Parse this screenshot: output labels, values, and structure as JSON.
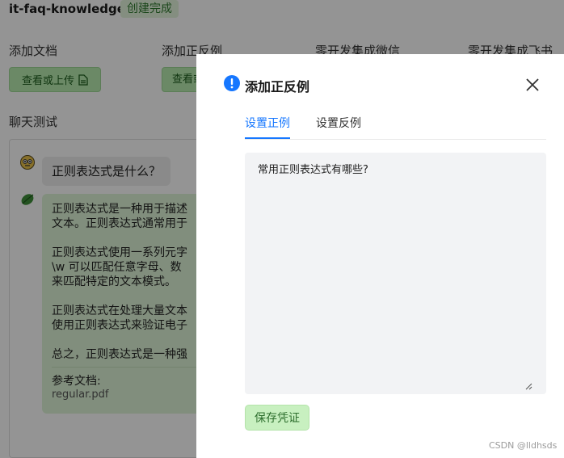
{
  "header": {
    "kb_name": "it-faq-knowledge",
    "status": "创建完成"
  },
  "sections": {
    "add_doc": "添加文档",
    "add_examples": "添加正反例",
    "wechat": "零开发集成微信",
    "feishu": "零开发集成飞书"
  },
  "upload_button": "查看或上传",
  "upload_button2": "查看或",
  "chat": {
    "title": "聊天测试",
    "question": "正则表达式是什么？",
    "answer_paragraphs": [
      [
        "正则表达式是一种用于描述",
        "文本。正则表达式通常用于"
      ],
      [
        "正则表达式使用一系列元字",
        "\\w 可以匹配任意字母、数",
        "来匹配特定的文本模式。"
      ],
      [
        "正则表达式在处理大量文本",
        "使用正则表达式来验证电子"
      ],
      [
        "总之，正则表达式是一种强"
      ]
    ],
    "ref_label": "参考文档:",
    "ref_file": "regular.pdf"
  },
  "modal": {
    "title": "添加正反例",
    "tabs": [
      "设置正例",
      "设置反例"
    ],
    "active_tab": 0,
    "textarea_value": "常用正则表达式有哪些?",
    "save_button": "保存凭证"
  },
  "watermark": "CSDN @lldhsds",
  "colors": {
    "accent": "#1677ff",
    "success_bg": "#c8f0c0",
    "overlay": "rgba(0,0,0,0.42)"
  },
  "icons": {
    "modal_icon": "info-circle-icon",
    "close": "close-icon",
    "upload": "file-icon",
    "user_avatar": "face-avatar-icon",
    "bot_avatar": "leaf-avatar-icon"
  }
}
